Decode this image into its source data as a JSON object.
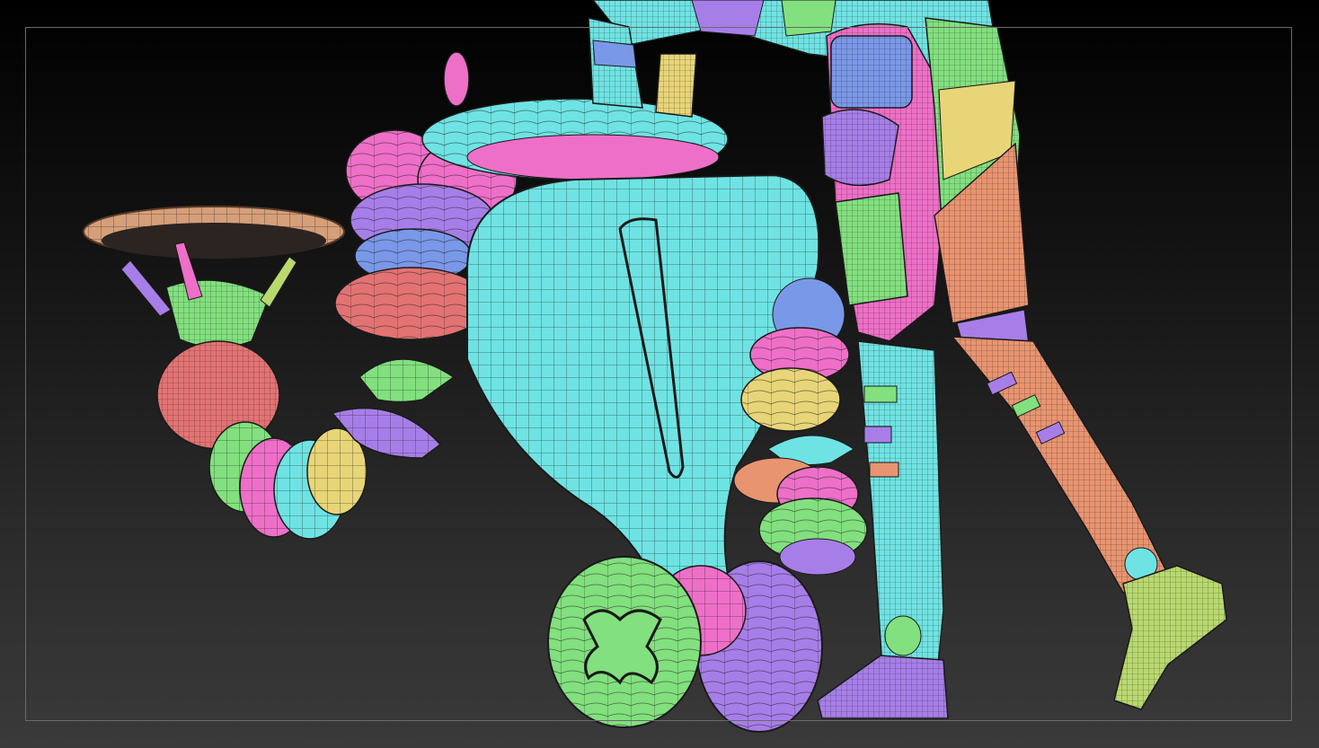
{
  "scene": {
    "background_top": "#000000",
    "background_bottom": "#3a3a3a",
    "frame_color": "#6a6a6a",
    "polygroup_colors": {
      "cyan": "#6fe3e3",
      "pink": "#ee6fc8",
      "purple": "#a77ee8",
      "blue": "#7a98e8",
      "red": "#e37373",
      "green": "#82e07e",
      "yellow": "#e8d578",
      "orange": "#e99470",
      "tan": "#d59f7a",
      "olive": "#b9d96f"
    },
    "wireframe_color": "#1a1a1a"
  }
}
